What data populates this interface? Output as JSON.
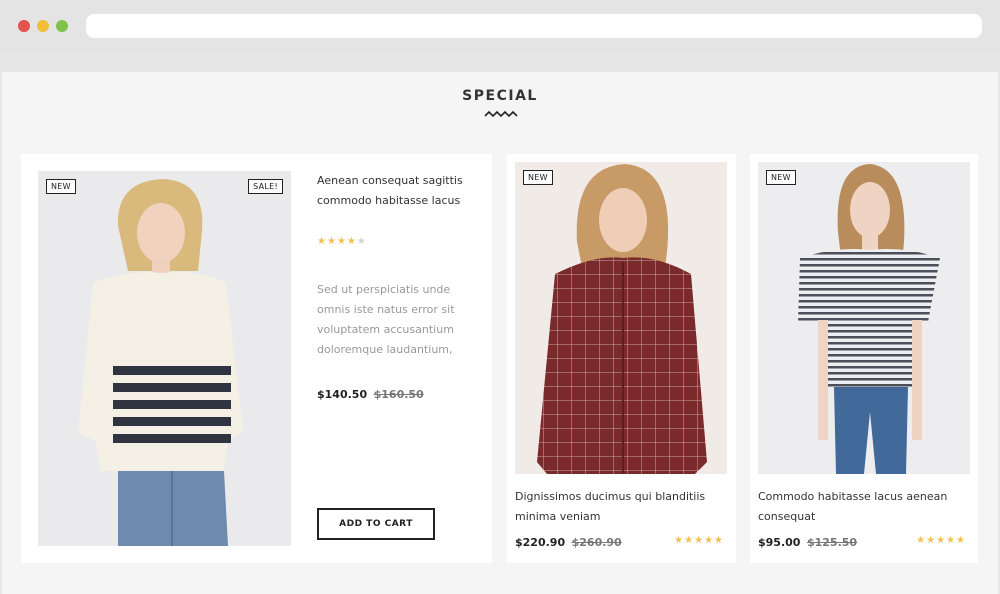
{
  "browser": {
    "window_buttons": [
      {
        "name": "close",
        "color": "#e5534b"
      },
      {
        "name": "minimize",
        "color": "#f2be3a"
      },
      {
        "name": "maximize",
        "color": "#7fc34a"
      }
    ],
    "address": ""
  },
  "section": {
    "title": "SPECIAL"
  },
  "colors": {
    "star_on": "#f2c14e",
    "star_off": "#d4d4d4",
    "page_bg": "#f5f5f5"
  },
  "featured": {
    "badges": {
      "new": "NEW",
      "sale": "SALE!"
    },
    "title": "Aenean consequat sagittis commodo habitasse lacus",
    "rating": 4,
    "rating_max": 5,
    "description": "Sed ut perspiciatis unde omnis iste natus error sit voluptatem accusantium doloremque laudantium,",
    "price": "$140.50",
    "old_price": "$160.50",
    "cart_label": "ADD TO CART"
  },
  "products": [
    {
      "badge": "NEW",
      "title": "Dignissimos ducimus qui blanditiis minima veniam",
      "price": "$220.90",
      "old_price": "$260.90",
      "rating": 5,
      "rating_max": 5
    },
    {
      "badge": "NEW",
      "title": "Commodo habitasse lacus aenean consequat",
      "price": "$95.00",
      "old_price": "$125.50",
      "rating": 5,
      "rating_max": 5
    }
  ]
}
